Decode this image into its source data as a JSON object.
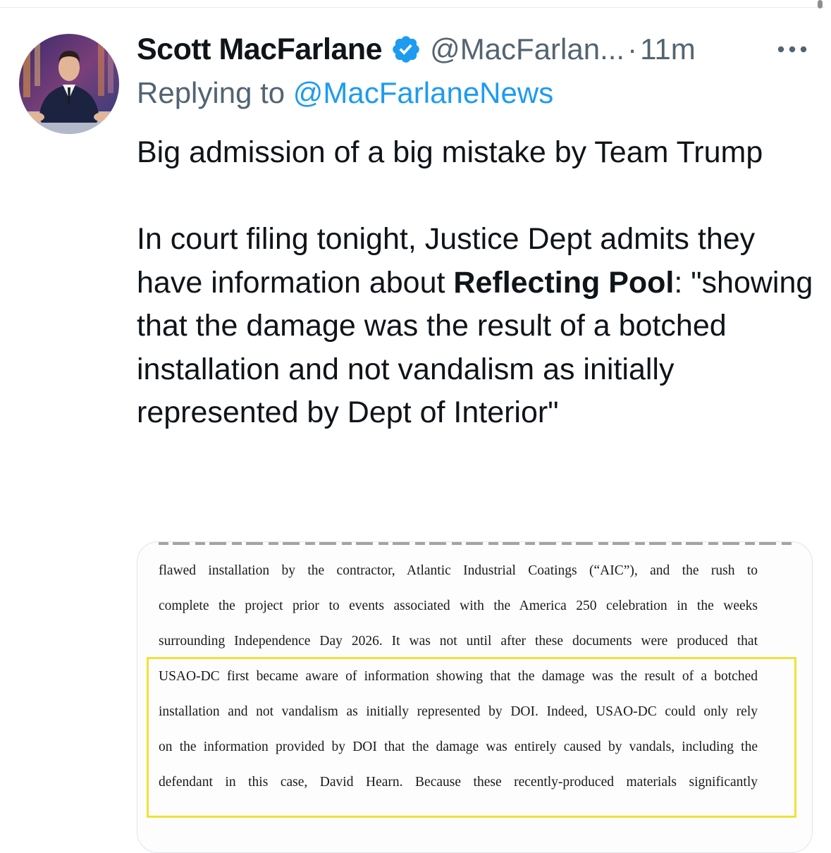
{
  "tweet": {
    "author_name": "Scott MacFarlane",
    "handle": "@MacFarlan...",
    "separator": "·",
    "timestamp": "11m",
    "replying_to_label": "Replying to",
    "replying_to_handle": "@MacFarlaneNews",
    "text_para1": "Big admission of a big mistake by Team Trump",
    "text_para2_part1": "In court filing tonight, Justice Dept admits they have information about ",
    "text_para2_bold": "Reflecting Pool",
    "text_para2_part2": ": \"showing that the damage was the result of a botched installation and not vandalism as initially represented by Dept of Interior\""
  },
  "document": {
    "lines": [
      "flawed installation by the contractor, Atlantic Industrial Coatings (“AIC”), and the rush to",
      "complete the project prior to events associated with the America 250 celebration in the weeks",
      "surrounding Independence Day 2026. It was not until after these documents were produced that",
      "USAO-DC first became aware of information showing that the damage was the result of a botched",
      "installation and not vandalism as initially represented by DOI.  Indeed, USAO-DC could only rely",
      "on the information provided by DOI that the damage was entirely caused by vandals, including the",
      "defendant in this case, David Hearn.  Because these recently-produced materials significantly"
    ],
    "highlight_color": "#efe23a"
  },
  "icons": {
    "verified": "verified-badge-icon",
    "more": "more-options-icon",
    "avatar": "profile-avatar"
  },
  "colors": {
    "link": "#1d9bf0",
    "secondary_text": "#536471",
    "primary_text": "#0f1419"
  }
}
